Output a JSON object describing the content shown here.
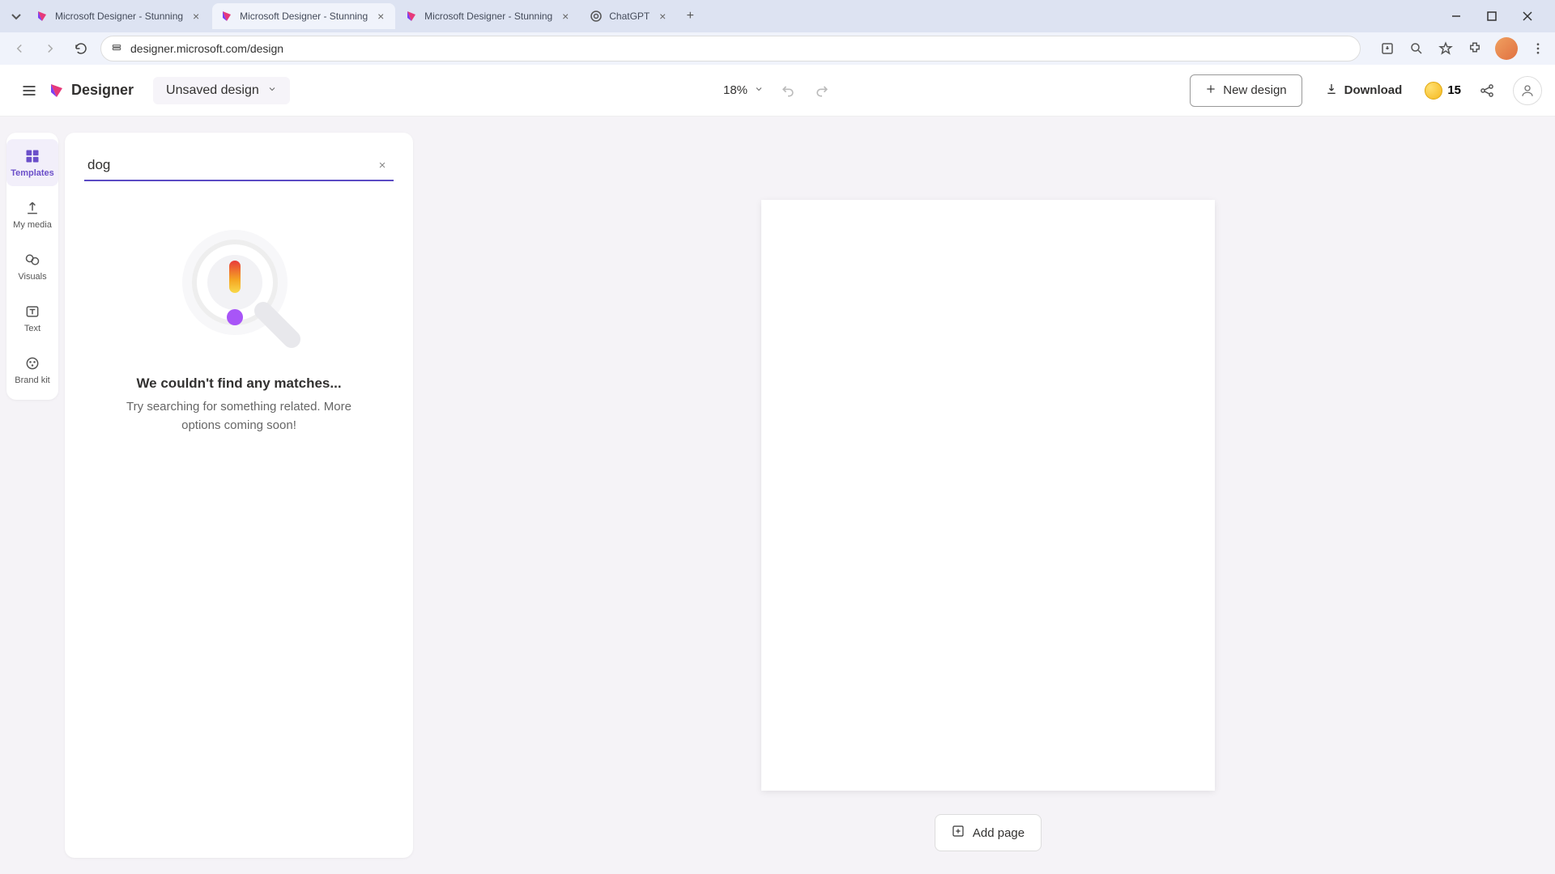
{
  "browser": {
    "tabs": [
      {
        "title": "Microsoft Designer - Stunning",
        "active": false,
        "favicon": "designer"
      },
      {
        "title": "Microsoft Designer - Stunning",
        "active": true,
        "favicon": "designer"
      },
      {
        "title": "Microsoft Designer - Stunning",
        "active": false,
        "favicon": "designer"
      },
      {
        "title": "ChatGPT",
        "active": false,
        "favicon": "chatgpt"
      }
    ],
    "url": "designer.microsoft.com/design"
  },
  "header": {
    "logo_text": "Designer",
    "design_name": "Unsaved design",
    "zoom": "18%",
    "new_design_label": "New design",
    "download_label": "Download",
    "coin_count": "15"
  },
  "rail": {
    "items": [
      {
        "label": "Templates",
        "icon": "templates",
        "active": true
      },
      {
        "label": "My media",
        "icon": "upload",
        "active": false
      },
      {
        "label": "Visuals",
        "icon": "visuals",
        "active": false
      },
      {
        "label": "Text",
        "icon": "text",
        "active": false
      },
      {
        "label": "Brand kit",
        "icon": "brandkit",
        "active": false
      }
    ]
  },
  "panel": {
    "search_value": "dog",
    "empty_title": "We couldn't find any matches...",
    "empty_sub": "Try searching for something related. More options coming soon!"
  },
  "canvas": {
    "add_page_label": "Add page"
  }
}
